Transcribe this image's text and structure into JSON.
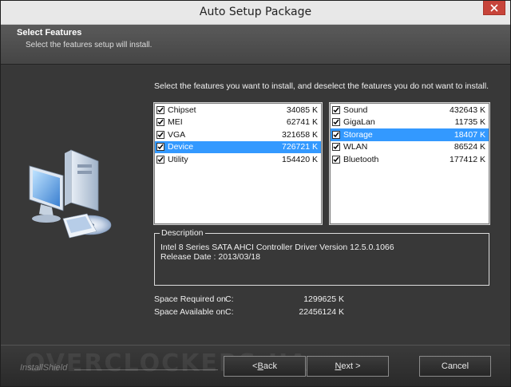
{
  "window": {
    "title": "Auto Setup Package"
  },
  "header": {
    "title": "Select Features",
    "subtitle": "Select the features setup will install."
  },
  "instruction": "Select the features you want to install, and deselect the features you do not want to install.",
  "left_list": [
    {
      "label": "Chipset",
      "size": "34085 K",
      "checked": true,
      "selected": false
    },
    {
      "label": "MEI",
      "size": "62741 K",
      "checked": true,
      "selected": false
    },
    {
      "label": "VGA",
      "size": "321658 K",
      "checked": true,
      "selected": false
    },
    {
      "label": "Device",
      "size": "726721 K",
      "checked": true,
      "selected": true
    },
    {
      "label": "Utility",
      "size": "154420 K",
      "checked": true,
      "selected": false
    }
  ],
  "right_list": [
    {
      "label": "Sound",
      "size": "432643 K",
      "checked": true,
      "selected": false
    },
    {
      "label": "GigaLan",
      "size": "11735 K",
      "checked": true,
      "selected": false
    },
    {
      "label": "Storage",
      "size": "18407 K",
      "checked": true,
      "selected": true
    },
    {
      "label": "WLAN",
      "size": "86524 K",
      "checked": true,
      "selected": false
    },
    {
      "label": "Bluetooth",
      "size": "177412 K",
      "checked": true,
      "selected": false
    }
  ],
  "description": {
    "legend": "Description",
    "line1": "Intel 8 Series SATA AHCI Controller Driver Version 12.5.0.1066",
    "line2": "Release Date : 2013/03/18"
  },
  "space": {
    "required_label": "Space Required on",
    "required_drive": "C:",
    "required_value": "1299625 K",
    "available_label": "Space Available on",
    "available_drive": "C:",
    "available_value": "22456124 K"
  },
  "footer": {
    "brand": "InstallShield",
    "watermark": "OVERCLOCKERS.UA"
  },
  "buttons": {
    "back_lt": "< ",
    "back_u": "B",
    "back_rest": "ack",
    "next_u": "N",
    "next_rest": "ext >",
    "cancel": "Cancel"
  },
  "colors": {
    "selection": "#3399ff",
    "close": "#c7443a"
  }
}
